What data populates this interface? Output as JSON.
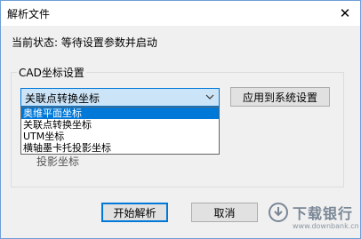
{
  "window": {
    "title": "解析文件",
    "close_glyph": "✕"
  },
  "status": {
    "text": "当前状态: 等待设置参数并启动"
  },
  "group": {
    "legend": "CAD坐标设置",
    "combo_value": "关联点转换坐标",
    "apply_label": "应用到系统设置",
    "dropdown_options": [
      "奥维平面坐标",
      "关联点转换坐标",
      "UTM坐标",
      "横轴墨卡托投影坐标"
    ],
    "selected_index": 0,
    "behind_text": "投影坐标"
  },
  "buttons": {
    "start_label": "开始解析",
    "cancel_label": "取消"
  },
  "watermark": {
    "name": "下载银行",
    "url": "www.downbank.cn"
  },
  "colors": {
    "accent": "#0078d7",
    "combo_bg": "#cce4f7",
    "dialog_bg": "#f0f0f0"
  }
}
